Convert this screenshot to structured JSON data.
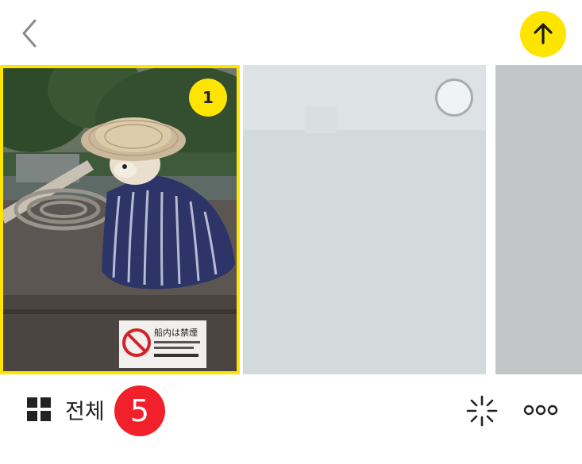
{
  "topbar": {
    "back_icon": "chevron-left-icon",
    "send_icon": "arrow-up-icon"
  },
  "photos": [
    {
      "selected": true,
      "selection_number": "1",
      "sign_text": "船内は禁煙"
    },
    {
      "selected": false
    },
    {
      "selected": false
    }
  ],
  "bottombar": {
    "view_label": "전체",
    "count": "5",
    "grid_icon": "grid-icon",
    "effects_icon": "sparkle-icon",
    "more_icon": "more-icon"
  },
  "colors": {
    "accent": "#fee500",
    "badge": "#f2202a",
    "text": "#222222"
  }
}
